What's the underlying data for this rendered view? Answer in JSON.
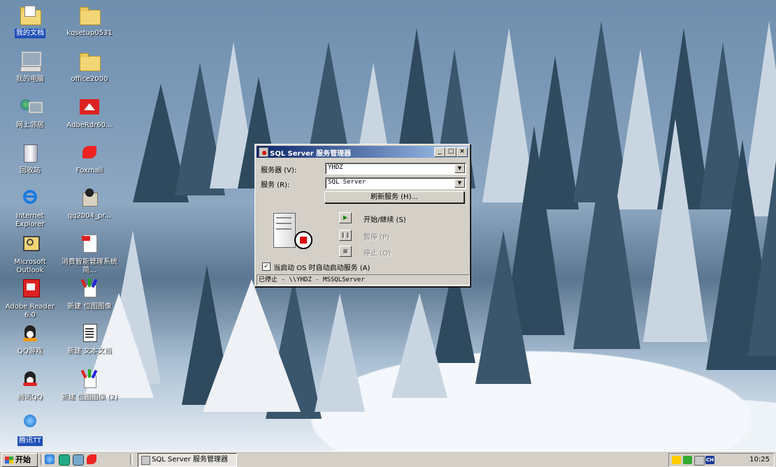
{
  "desktop": {
    "icons": [
      {
        "label": "我的文档",
        "icon": "my-documents-icon"
      },
      {
        "label": "kqsetup0531",
        "icon": "folder-icon"
      },
      {
        "label": "我的电脑",
        "icon": "my-computer-icon"
      },
      {
        "label": "office2000",
        "icon": "folder-icon"
      },
      {
        "label": "网上邻居",
        "icon": "network-places-icon"
      },
      {
        "label": "AdbeRdr60...",
        "icon": "adobe-installer-icon"
      },
      {
        "label": "回收站",
        "icon": "recycle-bin-icon"
      },
      {
        "label": "Foxmail",
        "icon": "foxmail-icon"
      },
      {
        "label": "Internet Explorer",
        "icon": "internet-explorer-icon"
      },
      {
        "label": "qq2004_pr...",
        "icon": "qq-installer-icon"
      },
      {
        "label": "Microsoft Outlook",
        "icon": "outlook-icon"
      },
      {
        "label": "消费智能管理系统简...",
        "icon": "pdf-document-icon"
      },
      {
        "label": "Adobe Reader 6.0",
        "icon": "adobe-reader-icon"
      },
      {
        "label": "新建 位图图像",
        "icon": "bitmap-image-icon"
      },
      {
        "label": "QQ游戏",
        "icon": "qq-game-icon"
      },
      {
        "label": "新建 文本文档",
        "icon": "text-document-icon"
      },
      {
        "label": "腾讯QQ",
        "icon": "qq-penguin-icon"
      },
      {
        "label": "新建 位图图像 (2)",
        "icon": "bitmap-image-icon"
      },
      {
        "label": "腾讯TT",
        "icon": "tencent-tt-icon"
      }
    ]
  },
  "dialog": {
    "title": "SQL Server 服务管理器",
    "server_label": "服务器 (V):",
    "server_value": "YHDZ",
    "service_label": "服务 (R):",
    "service_value": "SQL Server",
    "refresh_label": "刷新服务 (H)...",
    "start_label": "开始/继续 (S)",
    "pause_label": "暂停 (P)",
    "stop_label": "停止 (O)",
    "autostart_label": "当启动 OS 时自动启动服务 (A)",
    "autostart_checked": true,
    "status_text": "已停止 - \\\\YHDZ - MSSQLServer",
    "title_buttons": {
      "minimize": "_",
      "maximize": "□",
      "close": "×"
    }
  },
  "taskbar": {
    "start_label": "开始",
    "task_item": "SQL Server 服务管理器",
    "clock": "10:25",
    "tray_lang": "CH"
  },
  "colors": {
    "title_gradient_start": "#0a246a",
    "title_gradient_end": "#a6caf0",
    "face": "#d4d0c8",
    "stop_red": "#e00000",
    "play_green": "#008000"
  }
}
